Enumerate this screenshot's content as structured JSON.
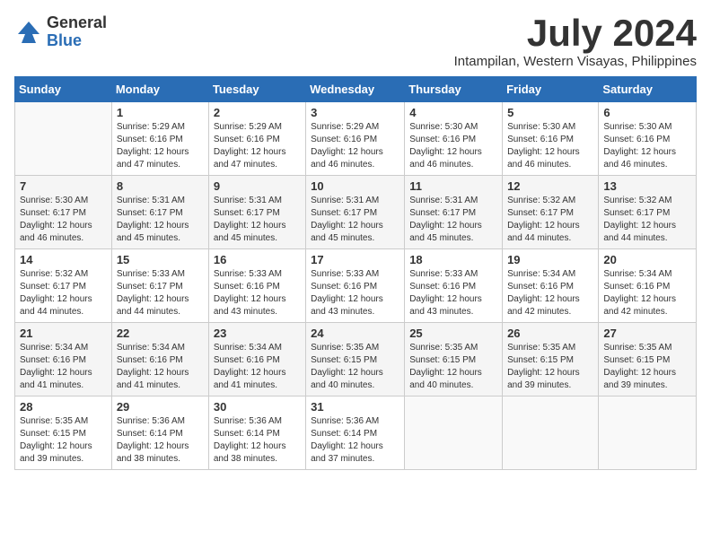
{
  "logo": {
    "general": "General",
    "blue": "Blue"
  },
  "title": {
    "month_year": "July 2024",
    "location": "Intampilan, Western Visayas, Philippines"
  },
  "headers": [
    "Sunday",
    "Monday",
    "Tuesday",
    "Wednesday",
    "Thursday",
    "Friday",
    "Saturday"
  ],
  "weeks": [
    [
      {
        "day": "",
        "info": ""
      },
      {
        "day": "1",
        "info": "Sunrise: 5:29 AM\nSunset: 6:16 PM\nDaylight: 12 hours\nand 47 minutes."
      },
      {
        "day": "2",
        "info": "Sunrise: 5:29 AM\nSunset: 6:16 PM\nDaylight: 12 hours\nand 47 minutes."
      },
      {
        "day": "3",
        "info": "Sunrise: 5:29 AM\nSunset: 6:16 PM\nDaylight: 12 hours\nand 46 minutes."
      },
      {
        "day": "4",
        "info": "Sunrise: 5:30 AM\nSunset: 6:16 PM\nDaylight: 12 hours\nand 46 minutes."
      },
      {
        "day": "5",
        "info": "Sunrise: 5:30 AM\nSunset: 6:16 PM\nDaylight: 12 hours\nand 46 minutes."
      },
      {
        "day": "6",
        "info": "Sunrise: 5:30 AM\nSunset: 6:16 PM\nDaylight: 12 hours\nand 46 minutes."
      }
    ],
    [
      {
        "day": "7",
        "info": "Sunrise: 5:30 AM\nSunset: 6:17 PM\nDaylight: 12 hours\nand 46 minutes."
      },
      {
        "day": "8",
        "info": "Sunrise: 5:31 AM\nSunset: 6:17 PM\nDaylight: 12 hours\nand 45 minutes."
      },
      {
        "day": "9",
        "info": "Sunrise: 5:31 AM\nSunset: 6:17 PM\nDaylight: 12 hours\nand 45 minutes."
      },
      {
        "day": "10",
        "info": "Sunrise: 5:31 AM\nSunset: 6:17 PM\nDaylight: 12 hours\nand 45 minutes."
      },
      {
        "day": "11",
        "info": "Sunrise: 5:31 AM\nSunset: 6:17 PM\nDaylight: 12 hours\nand 45 minutes."
      },
      {
        "day": "12",
        "info": "Sunrise: 5:32 AM\nSunset: 6:17 PM\nDaylight: 12 hours\nand 44 minutes."
      },
      {
        "day": "13",
        "info": "Sunrise: 5:32 AM\nSunset: 6:17 PM\nDaylight: 12 hours\nand 44 minutes."
      }
    ],
    [
      {
        "day": "14",
        "info": "Sunrise: 5:32 AM\nSunset: 6:17 PM\nDaylight: 12 hours\nand 44 minutes."
      },
      {
        "day": "15",
        "info": "Sunrise: 5:33 AM\nSunset: 6:17 PM\nDaylight: 12 hours\nand 44 minutes."
      },
      {
        "day": "16",
        "info": "Sunrise: 5:33 AM\nSunset: 6:16 PM\nDaylight: 12 hours\nand 43 minutes."
      },
      {
        "day": "17",
        "info": "Sunrise: 5:33 AM\nSunset: 6:16 PM\nDaylight: 12 hours\nand 43 minutes."
      },
      {
        "day": "18",
        "info": "Sunrise: 5:33 AM\nSunset: 6:16 PM\nDaylight: 12 hours\nand 43 minutes."
      },
      {
        "day": "19",
        "info": "Sunrise: 5:34 AM\nSunset: 6:16 PM\nDaylight: 12 hours\nand 42 minutes."
      },
      {
        "day": "20",
        "info": "Sunrise: 5:34 AM\nSunset: 6:16 PM\nDaylight: 12 hours\nand 42 minutes."
      }
    ],
    [
      {
        "day": "21",
        "info": "Sunrise: 5:34 AM\nSunset: 6:16 PM\nDaylight: 12 hours\nand 41 minutes."
      },
      {
        "day": "22",
        "info": "Sunrise: 5:34 AM\nSunset: 6:16 PM\nDaylight: 12 hours\nand 41 minutes."
      },
      {
        "day": "23",
        "info": "Sunrise: 5:34 AM\nSunset: 6:16 PM\nDaylight: 12 hours\nand 41 minutes."
      },
      {
        "day": "24",
        "info": "Sunrise: 5:35 AM\nSunset: 6:15 PM\nDaylight: 12 hours\nand 40 minutes."
      },
      {
        "day": "25",
        "info": "Sunrise: 5:35 AM\nSunset: 6:15 PM\nDaylight: 12 hours\nand 40 minutes."
      },
      {
        "day": "26",
        "info": "Sunrise: 5:35 AM\nSunset: 6:15 PM\nDaylight: 12 hours\nand 39 minutes."
      },
      {
        "day": "27",
        "info": "Sunrise: 5:35 AM\nSunset: 6:15 PM\nDaylight: 12 hours\nand 39 minutes."
      }
    ],
    [
      {
        "day": "28",
        "info": "Sunrise: 5:35 AM\nSunset: 6:15 PM\nDaylight: 12 hours\nand 39 minutes."
      },
      {
        "day": "29",
        "info": "Sunrise: 5:36 AM\nSunset: 6:14 PM\nDaylight: 12 hours\nand 38 minutes."
      },
      {
        "day": "30",
        "info": "Sunrise: 5:36 AM\nSunset: 6:14 PM\nDaylight: 12 hours\nand 38 minutes."
      },
      {
        "day": "31",
        "info": "Sunrise: 5:36 AM\nSunset: 6:14 PM\nDaylight: 12 hours\nand 37 minutes."
      },
      {
        "day": "",
        "info": ""
      },
      {
        "day": "",
        "info": ""
      },
      {
        "day": "",
        "info": ""
      }
    ]
  ]
}
